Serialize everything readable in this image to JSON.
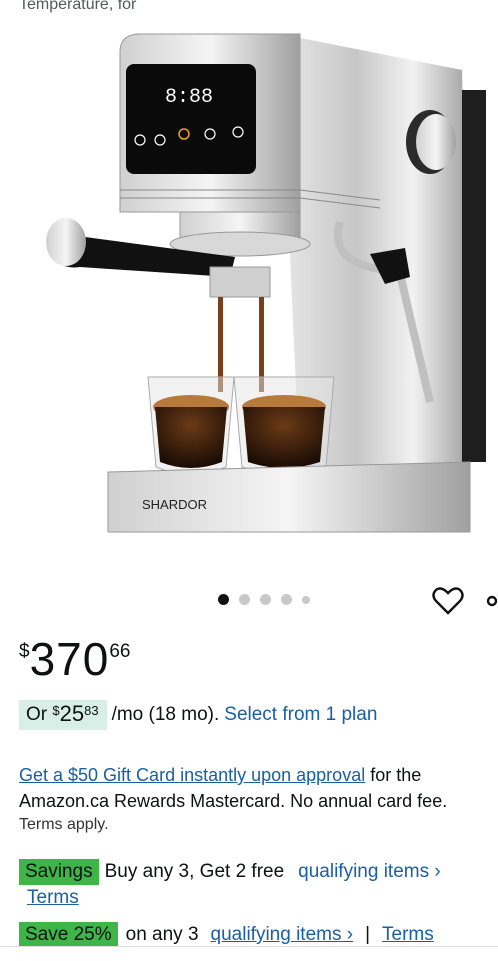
{
  "top_text": "Temperature, for",
  "product": {
    "brand_label": "SHARDOR",
    "display_text": "8:88"
  },
  "carousel": {
    "total": 5,
    "active": 1
  },
  "price": {
    "symbol": "$",
    "whole": "370",
    "fraction": "66"
  },
  "monthly": {
    "prefix": "Or ",
    "symbol": "$",
    "whole": "25",
    "fraction": "83",
    "rest": "/mo (18 mo).",
    "link": "Select from 1 plan"
  },
  "gift_card": {
    "link": "Get a $50 Gift Card instantly upon approval",
    "text1": " for the",
    "line2": "Amazon.ca Rewards Mastercard. No annual card fee.",
    "terms": "Terms apply."
  },
  "savings": {
    "badge": "Savings",
    "text": "Buy any 3, Get 2 free",
    "link": "qualifying items ›",
    "terms": "Terms"
  },
  "save_row": {
    "badge": "Save 25%",
    "text": "on any 3",
    "link": "qualifying items ›",
    "separator": "|",
    "terms": "Terms"
  },
  "colors": {
    "link": "#1a5fa0",
    "savings_badge": "#3fb449",
    "monthly_bg": "#d7efe6"
  }
}
